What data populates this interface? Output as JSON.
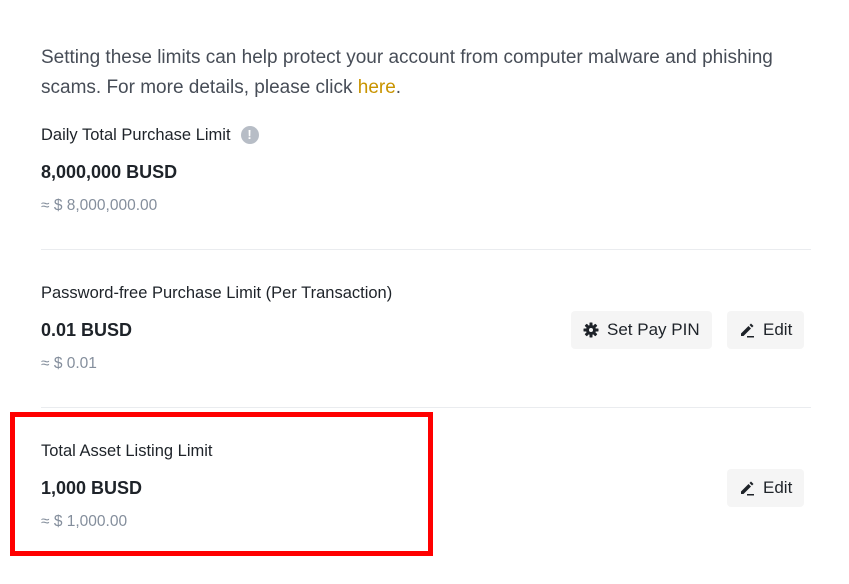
{
  "intro": {
    "text": "Setting these limits can help protect your account from computer malware and phishing scams. For more details, please click ",
    "link": "here",
    "suffix": "."
  },
  "limits": [
    {
      "label": "Daily Total Purchase Limit",
      "value": "8,000,000 BUSD",
      "approx": "≈ $ 8,000,000.00",
      "info_icon": "exclamation-circle-icon"
    },
    {
      "label": "Password-free Purchase Limit (Per Transaction)",
      "value": "0.01 BUSD",
      "approx": "≈ $ 0.01",
      "set_pin_label": "Set Pay PIN",
      "edit_label": "Edit"
    },
    {
      "label": "Total Asset Listing Limit",
      "value": "1,000 BUSD",
      "approx": "≈ $ 1,000.00",
      "edit_label": "Edit"
    }
  ],
  "colors": {
    "link": "#c99400",
    "highlight": "#ff0000",
    "muted": "#848e9c",
    "button_bg": "#f5f5f5"
  }
}
